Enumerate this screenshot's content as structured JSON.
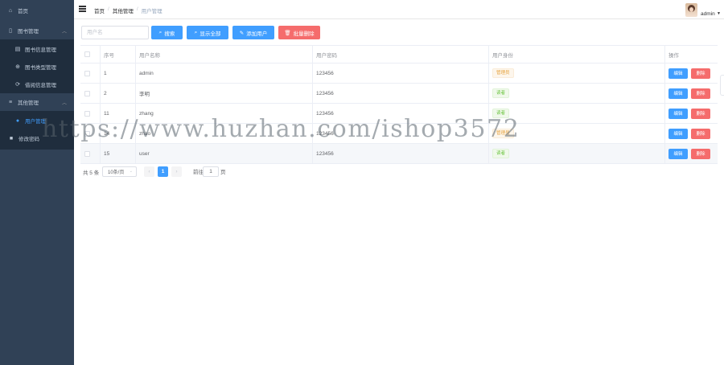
{
  "sidebar": {
    "items": [
      {
        "label": "首页",
        "icon": "home-icon"
      },
      {
        "label": "图书管理",
        "icon": "book-icon",
        "expanded": true
      },
      {
        "label": "图书信息管理",
        "icon": "document-icon"
      },
      {
        "label": "图书类型管理",
        "icon": "circle-plus-icon"
      },
      {
        "label": "借阅信息管理",
        "icon": "refresh-icon"
      },
      {
        "label": "其他管理",
        "icon": "menu-icon",
        "expanded": true
      },
      {
        "label": "用户管理",
        "icon": "user-icon",
        "active": true
      },
      {
        "label": "修改密码",
        "icon": "lock-icon"
      }
    ],
    "active_color": "#409eff",
    "background": "#304156"
  },
  "header": {
    "breadcrumb": [
      "首页",
      "其他管理",
      "用户管理"
    ],
    "separator": "/",
    "username": "admin"
  },
  "toolbar": {
    "search_placeholder": "用户名",
    "search_label": "搜索",
    "show_all_label": "显示全部",
    "add_label": "添加用户",
    "batch_delete_label": "批量删除"
  },
  "table": {
    "columns": [
      "序号",
      "用户名称",
      "用户密码",
      "用户身份",
      "操作"
    ],
    "rows": [
      {
        "id": "1",
        "name": "admin",
        "password": "123456",
        "role": "管理员",
        "role_type": "warn"
      },
      {
        "id": "2",
        "name": "李明",
        "password": "123456",
        "role": "读者",
        "role_type": "ok"
      },
      {
        "id": "11",
        "name": "zhang",
        "password": "123456",
        "role": "读者",
        "role_type": "ok"
      },
      {
        "id": "14",
        "name": "zhao",
        "password": "123456",
        "role": "管理员",
        "role_type": "warn"
      },
      {
        "id": "15",
        "name": "user",
        "password": "123456",
        "role": "读者",
        "role_type": "ok"
      }
    ],
    "edit_label": "编辑",
    "delete_label": "删除"
  },
  "pagination": {
    "total_label": "共 5 条",
    "page_size": "10条/页",
    "prev": "‹",
    "current_page": "1",
    "next": "›",
    "goto_prefix": "前往",
    "goto_value": "1",
    "goto_suffix": "页"
  },
  "watermark": "https://www.huzhan.com/ishop3572"
}
